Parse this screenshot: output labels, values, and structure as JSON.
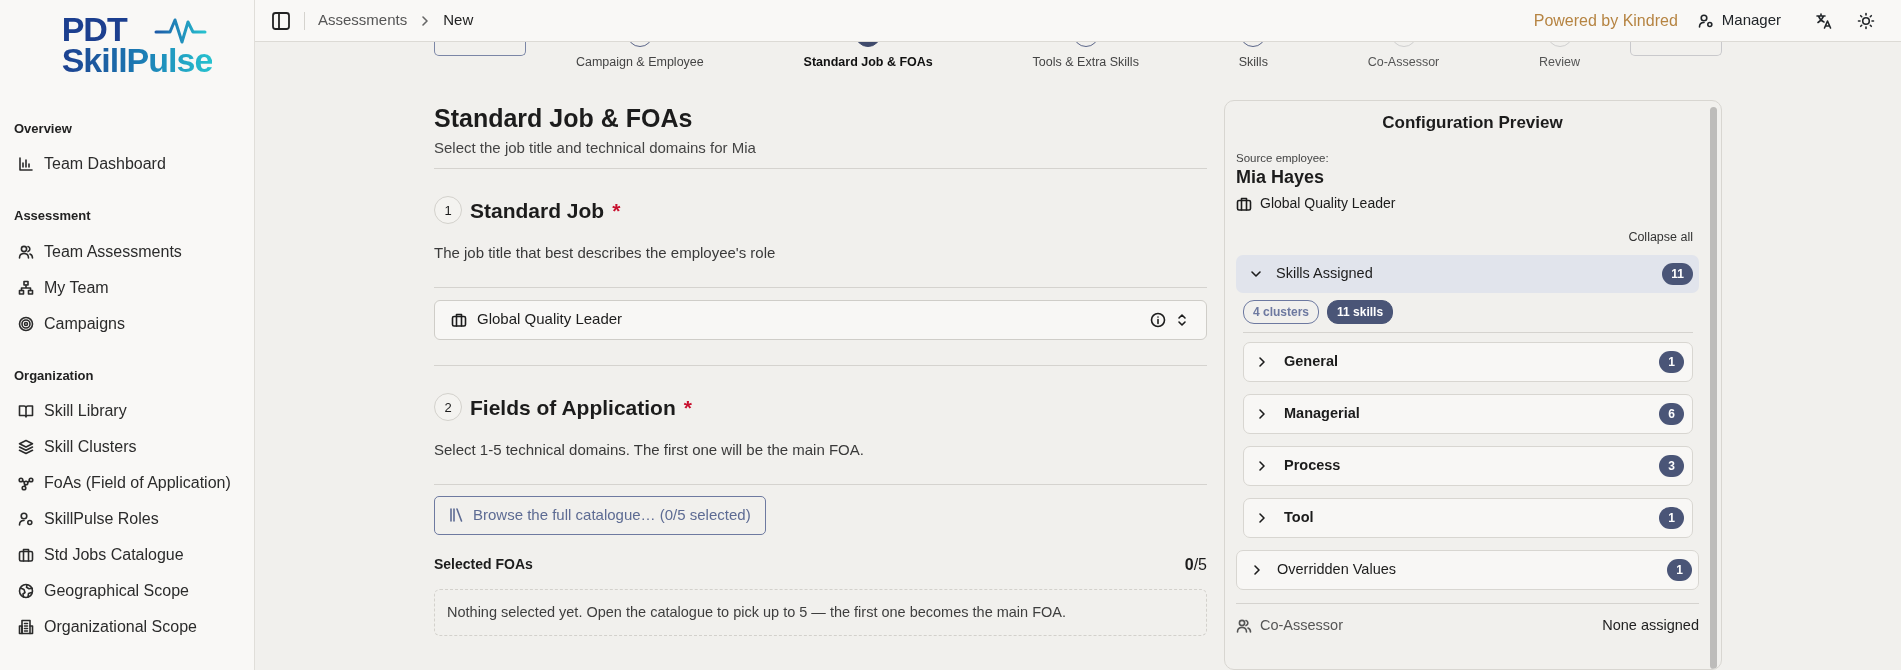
{
  "sidebar": {
    "logo": {
      "line_1": "PDT",
      "line_2": "SkillPulse"
    },
    "sections": [
      {
        "title": "Overview",
        "items": [
          {
            "label": "Team Dashboard",
            "selected": false
          }
        ]
      },
      {
        "title": "Assessment",
        "items": [
          {
            "label": "Team Assessments",
            "selected": false
          },
          {
            "label": "My Team",
            "selected": false
          },
          {
            "label": "Campaigns",
            "selected": false
          }
        ]
      },
      {
        "title": "Organization",
        "items": [
          {
            "label": "Skill Library",
            "selected": false
          },
          {
            "label": "Skill Clusters",
            "selected": false
          },
          {
            "label": "FoAs (Field of Application)",
            "selected": false
          },
          {
            "label": "SkillPulse Roles",
            "selected": false
          },
          {
            "label": "Std Jobs Catalogue",
            "selected": false
          },
          {
            "label": "Geographical Scope",
            "selected": false
          },
          {
            "label": "Organizational Scope",
            "selected": false
          }
        ]
      }
    ]
  },
  "header": {
    "breadcrumb": [
      "Assessments",
      "New"
    ],
    "powered_by": "Powered by Kindred",
    "role": "Manager"
  },
  "stepper": {
    "next_disabled": true,
    "steps": [
      {
        "label": "Campaign & Employee",
        "selected": false,
        "reached": true
      },
      {
        "label": "Standard Job & FOAs",
        "selected": true,
        "reached": true
      },
      {
        "label": "Tools & Extra Skills",
        "selected": false,
        "reached": true
      },
      {
        "label": "Skills",
        "selected": false,
        "reached": true
      },
      {
        "label": "Co-Assessor",
        "selected": false,
        "reached": false
      },
      {
        "label": "Review",
        "selected": false,
        "reached": false
      }
    ]
  },
  "main": {
    "title": "Standard Job & FOAs",
    "subtitle": "Select the job title and technical domains for Mia",
    "sections": [
      {
        "number": "1",
        "title": "Standard Job",
        "required_mark": "*",
        "description": "The job title that best describes the employee's role"
      },
      {
        "number": "2",
        "title": "Fields of Application",
        "required_mark": "*",
        "description": "Select 1-5 technical domains. The first one will be the main FOA."
      }
    ],
    "job_select": {
      "value": "Global Quality Leader"
    },
    "browse_button": "Browse the full catalogue… (0/5 selected)",
    "selected_foas": {
      "label": "Selected FOAs",
      "count": "**0**/5",
      "empty_text": "Nothing selected yet. Open the catalogue to pick up to 5 — the first one becomes the main FOA."
    }
  },
  "preview": {
    "title": "Configuration Preview",
    "source_label": "Source employee:",
    "employee_name": "Mia Hayes",
    "job_title": "Global Quality Leader",
    "collapse_all": "Collapse all",
    "skills_group": {
      "label": "Skills Assigned",
      "count": "11",
      "expanded": true,
      "chips": [
        {
          "label": "4 clusters",
          "kind": "outline"
        },
        {
          "label": "11 skills",
          "kind": "filled"
        }
      ],
      "clusters": [
        {
          "label": "General",
          "count": "1",
          "expanded": false
        },
        {
          "label": "Managerial",
          "count": "6",
          "expanded": false
        },
        {
          "label": "Process",
          "count": "3",
          "expanded": false
        },
        {
          "label": "Tool",
          "count": "1",
          "expanded": false
        }
      ]
    },
    "overridden": {
      "label": "Overridden Values",
      "count": "1",
      "expanded": false
    },
    "co_assessor": {
      "label": "Co-Assessor",
      "value": "None assigned"
    }
  }
}
